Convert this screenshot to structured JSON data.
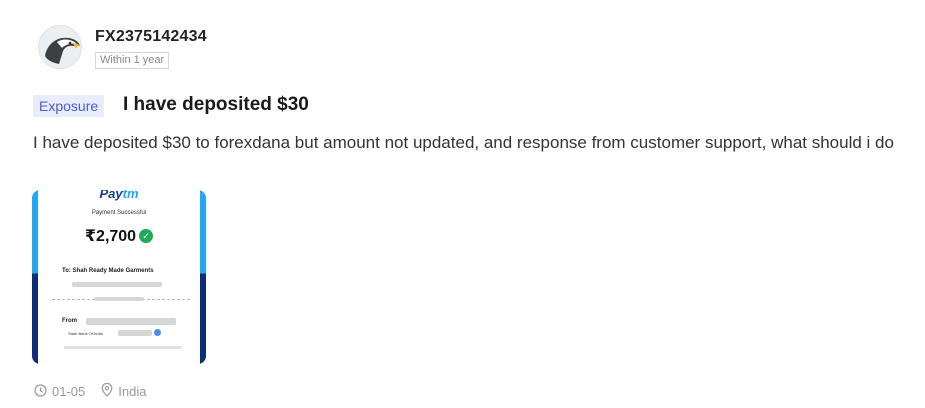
{
  "post": {
    "username": "FX2375142434",
    "time_badge": "Within 1 year",
    "tag": "Exposure",
    "title": "I have deposited $30",
    "content": "I have deposited $30 to forexdana but amount not updated, and response from customer support, what should i do",
    "date": "01-05",
    "location": "India"
  },
  "receipt": {
    "brand_a": "Pay",
    "brand_b": "tm",
    "status": "Payment Successful",
    "amount": "₹2,700",
    "to_line": "To: Shah Ready Made Garments",
    "from_label": "From",
    "bank": "State Bank Of India"
  },
  "icons": {
    "avatar": "eagle-avatar-icon",
    "clock": "clock-icon",
    "location": "location-pin-icon",
    "verified": "check-badge-icon"
  },
  "colors": {
    "tag_bg": "#e8ecfc",
    "tag_text": "#4a5cd6",
    "paytm_blue": "#21a9ef",
    "paytm_navy": "#0e2f78",
    "success_green": "#1faa59"
  }
}
